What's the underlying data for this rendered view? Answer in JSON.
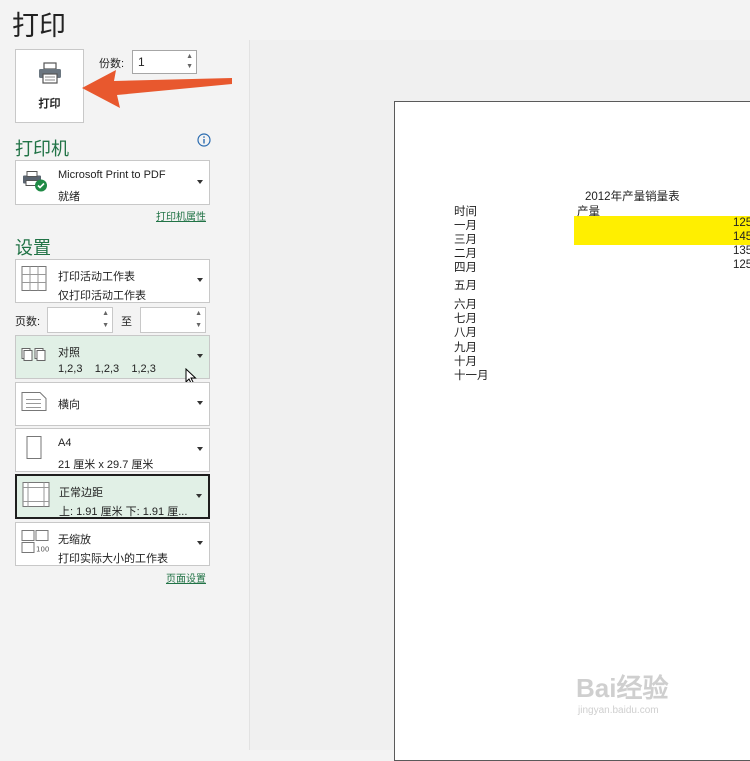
{
  "header": {
    "title": "打印"
  },
  "print_button": {
    "label": "打印"
  },
  "copies": {
    "label": "份数:",
    "value": "1"
  },
  "printer": {
    "section_title": "打印机",
    "name": "Microsoft Print to PDF",
    "status": "就绪",
    "properties_link": "打印机属性"
  },
  "settings": {
    "section_title": "设置",
    "what": {
      "line1": "打印活动工作表",
      "line2": "仅打印活动工作表"
    },
    "pages": {
      "label": "页数:",
      "to_label": "至"
    },
    "collate": {
      "line1": "对照",
      "line2": "1,2,3    1,2,3    1,2,3"
    },
    "orientation": {
      "label": "横向"
    },
    "paper": {
      "line1": "A4",
      "line2": "21 厘米 x 29.7 厘米"
    },
    "margins": {
      "line1": "正常边距",
      "line2": "上: 1.91 厘米 下: 1.91 厘..."
    },
    "scaling": {
      "line1": "无缩放",
      "line2": "打印实际大小的工作表"
    },
    "page_setup_link": "页面设置"
  },
  "preview": {
    "title": "2012年产量销量表",
    "col_time": "时间",
    "col_output": "产量",
    "months": [
      "一月",
      "三月",
      "二月",
      "四月",
      "五月",
      "六月",
      "七月",
      "八月",
      "九月",
      "十月",
      "十一月"
    ],
    "values": [
      "125",
      "145",
      "135",
      "125"
    ],
    "highlight_color": "#ffef00"
  },
  "watermark": {
    "logo": "Bai经验",
    "url": "jingyan.baidu.com"
  },
  "colors": {
    "accent": "#217346",
    "arrow": "#e8582e"
  }
}
